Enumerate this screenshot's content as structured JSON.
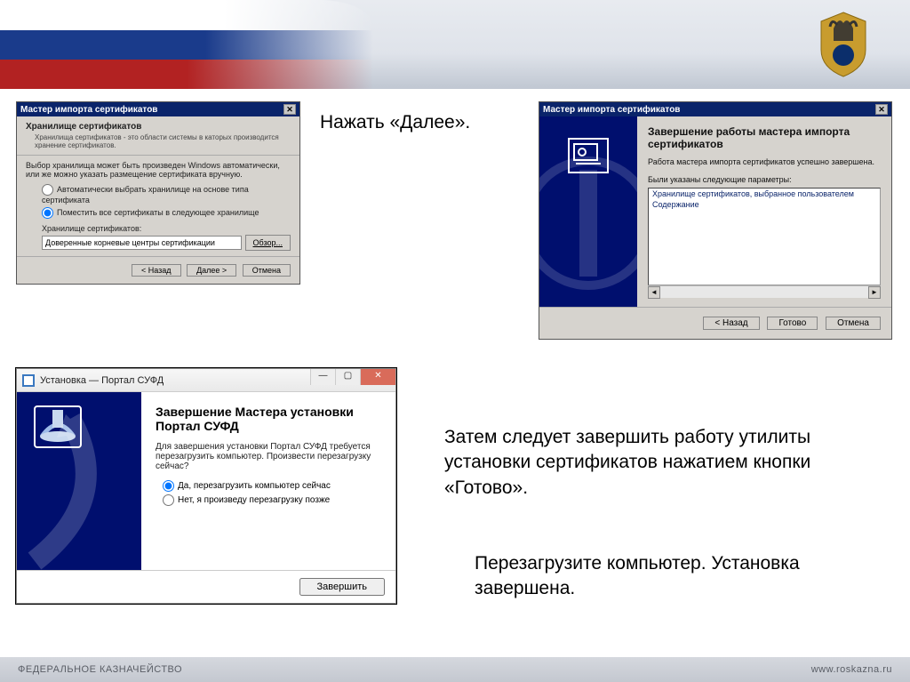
{
  "annot": {
    "a1": "Нажать «Далее».",
    "a2": "Затем следует завершить работу утилиты установки сертификатов нажатием кнопки «Готово».",
    "a3": "Перезагрузите компьютер. Установка завершена."
  },
  "dlg1": {
    "title": "Мастер импорта сертификатов",
    "panel_head": "Хранилище сертификатов",
    "panel_sub": "Хранилища сертификатов - это области системы в каторых производится хранение сертификатов.",
    "desc": "Выбор хранилища может быть произведен Windows автоматически, или же можно указать размещение сертификата вручную.",
    "radio_auto": "Автоматически выбрать хранилище на основе типа сертификата",
    "radio_manual": "Поместить все сертификаты в следующее хранилище",
    "store_label": "Хранилище сертификатов:",
    "store_value": "Доверенные корневые центры сертификации",
    "browse": "Обзор...",
    "back": "< Назад",
    "next": "Далее >",
    "cancel": "Отмена"
  },
  "dlg2": {
    "title": "Мастер импорта сертификатов",
    "heading": "Завершение работы мастера импорта сертификатов",
    "line": "Работа мастера импорта сертификатов успешно завершена.",
    "list_label": "Были указаны следующие параметры:",
    "row1": "Хранилище сертификатов, выбранное пользователем",
    "row2": "Содержание",
    "back": "< Назад",
    "done": "Готово",
    "cancel": "Отмена"
  },
  "dlg3": {
    "title": "Установка — Портал СУФД",
    "heading": "Завершение Мастера установки Портал СУФД",
    "para": "Для завершения установки Портал СУФД требуется перезагрузить компьютер. Произвести перезагрузку сейчас?",
    "radio_now": "Да, перезагрузить компьютер сейчас",
    "radio_later": "Нет, я произведу перезагрузку позже",
    "finish": "Завершить"
  },
  "footer": {
    "org": "ФЕДЕРАЛЬНОЕ КАЗНАЧЕЙСТВО",
    "url": "www.roskazna.ru"
  }
}
